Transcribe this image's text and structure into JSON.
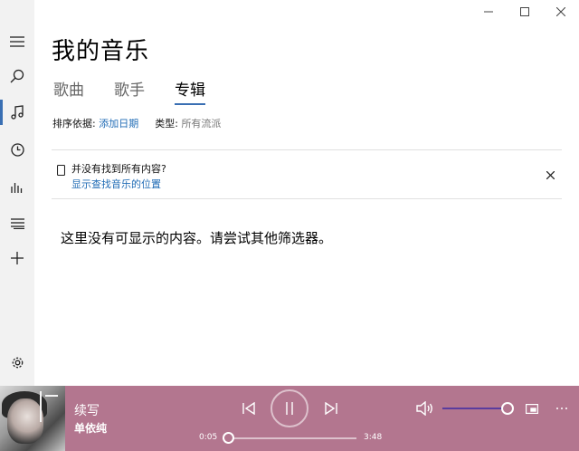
{
  "window": {
    "controls": [
      "minimize-icon",
      "maximize-icon",
      "close-icon"
    ]
  },
  "sidebar": {
    "items": [
      {
        "icon": "hamburger-menu-icon"
      },
      {
        "icon": "search-icon"
      },
      {
        "icon": "music-note-icon",
        "active": true
      },
      {
        "icon": "recent-clock-icon"
      },
      {
        "icon": "now-playing-bars-icon"
      },
      {
        "icon": "playlist-icon"
      },
      {
        "icon": "add-icon"
      },
      {
        "icon": "settings-gear-icon"
      }
    ]
  },
  "page": {
    "title": "我的音乐",
    "tabs": [
      {
        "label": "歌曲"
      },
      {
        "label": "歌手"
      },
      {
        "label": "专辑",
        "selected": true
      }
    ]
  },
  "filters": {
    "sort_label": "排序依据:",
    "sort_value": "添加日期",
    "type_label": "类型:",
    "type_value": "所有流派"
  },
  "notice": {
    "title": "并没有找到所有内容?",
    "link": "显示查找音乐的位置"
  },
  "empty_message": "这里没有可显示的内容。请尝试其他筛选器。",
  "player": {
    "song_title": "续写",
    "artist": "单依纯",
    "current_time": "0:05",
    "total_time": "3:48",
    "progress_fraction": 0.022,
    "volume_fraction": 1.0,
    "state": "playing",
    "accent_color": "#b3768f"
  },
  "colors": {
    "accent_blue": "#1f6bb5",
    "player_bg": "#b3768f",
    "volume_track": "#5a3c9e"
  }
}
